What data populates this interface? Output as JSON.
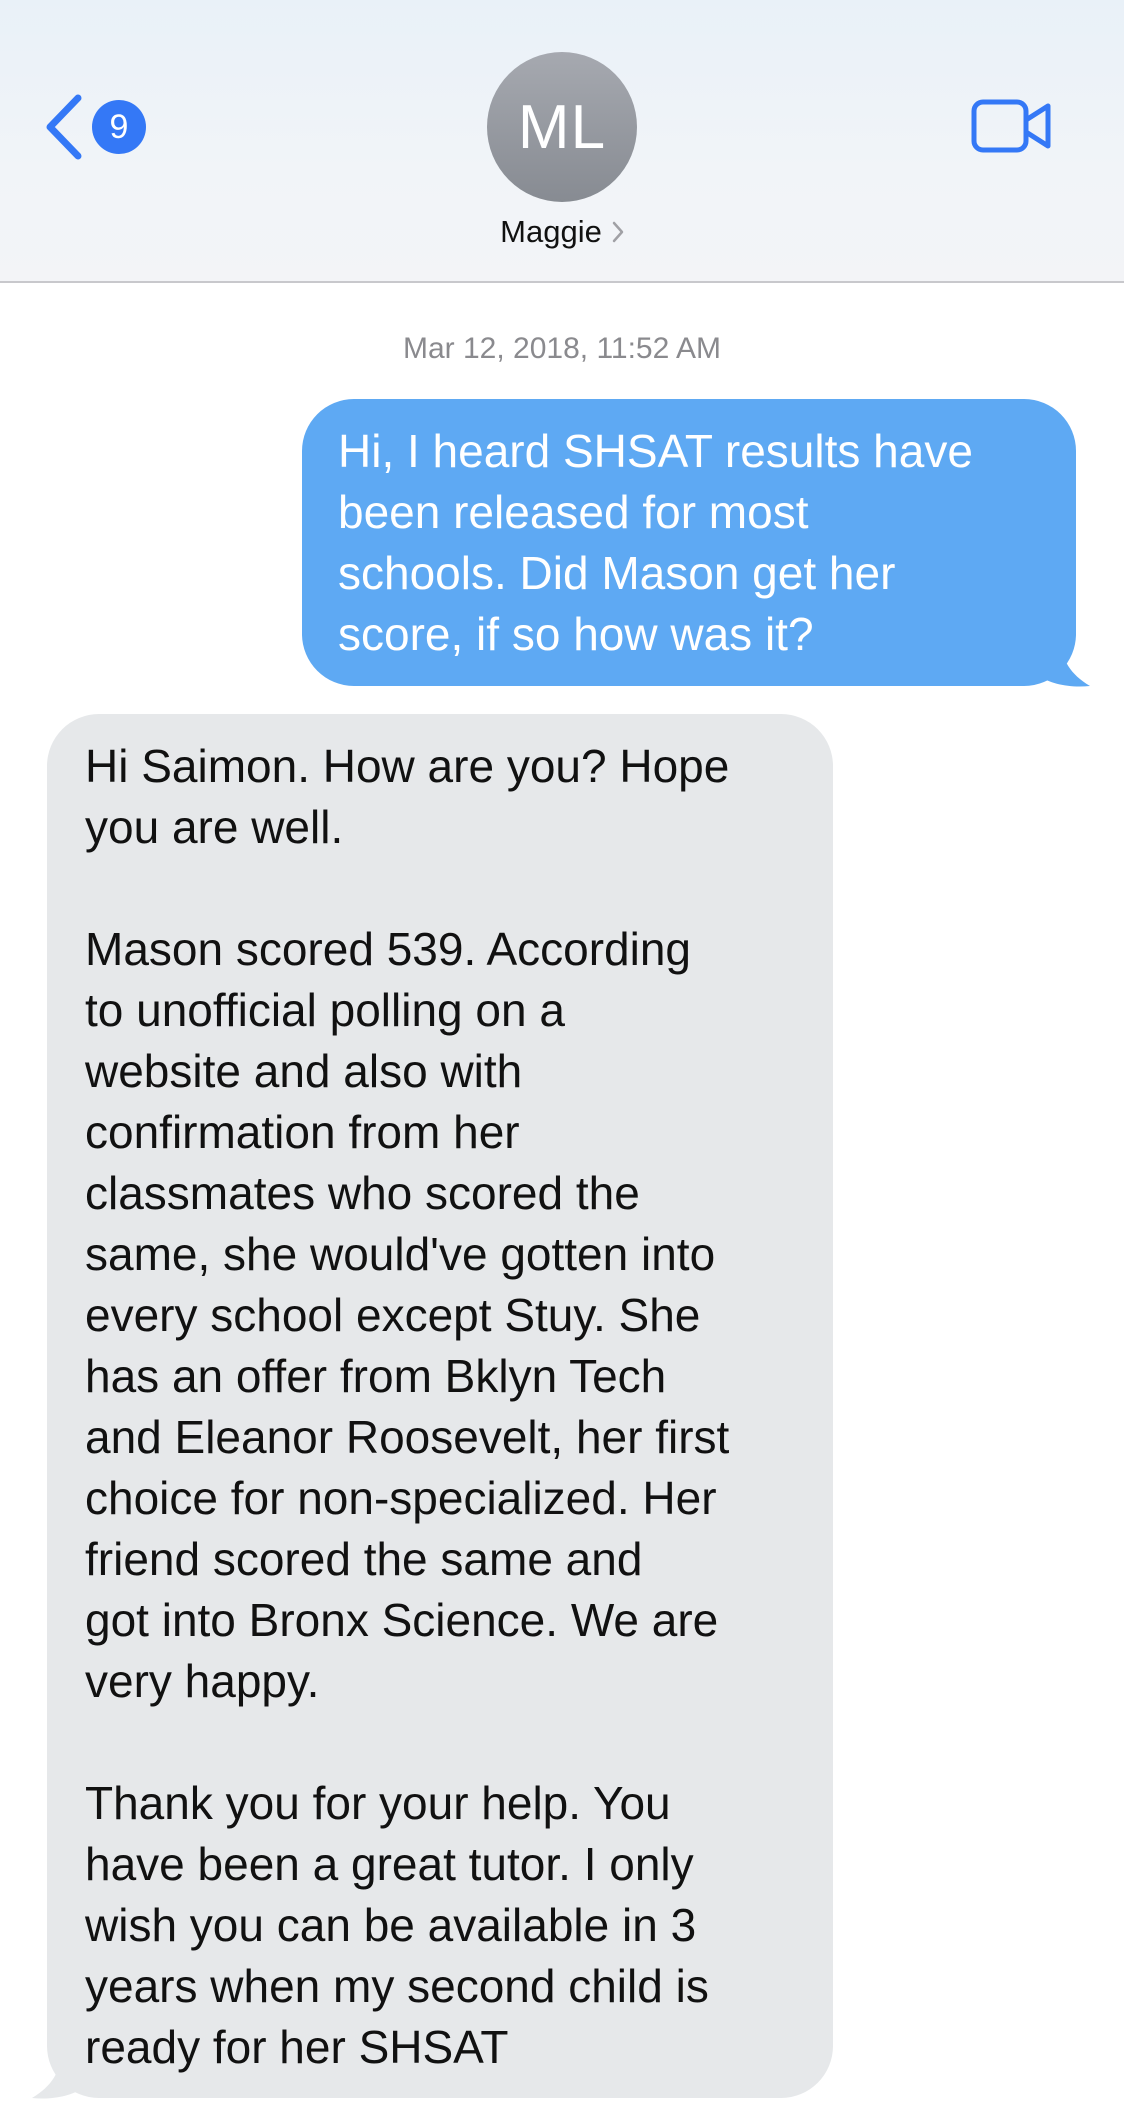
{
  "header": {
    "back_badge_count": "9",
    "avatar_initials": "ML",
    "contact_name": "Maggie"
  },
  "conversation": {
    "timestamp": "Mar 12, 2018, 11:52 AM",
    "messages": [
      {
        "direction": "sent",
        "text": "Hi, I heard SHSAT results have\nbeen released for most\nschools. Did Mason get her\nscore, if so how was it?"
      },
      {
        "direction": "received",
        "text": "Hi Saimon. How are you? Hope\nyou are well.\n\nMason scored 539. According\nto unofficial polling on a\nwebsite and also with\nconfirmation from her\nclassmates who scored the\nsame, she would've gotten into\nevery school except Stuy. She\nhas an offer from Bklyn Tech\nand Eleanor Roosevelt, her first\nchoice for non-specialized. Her\nfriend scored the same and\ngot into Bronx Science. We are\nvery happy.\n\nThank you for your help. You\nhave been a great tutor. I only\nwish you can be available in 3\nyears when my second child is\nready for her SHSAT"
      }
    ]
  },
  "colors": {
    "accent": "#3478f6",
    "sent_bubble": "#5ea9f3",
    "received_bubble": "#e6e8ea",
    "timestamp_text": "#8a8a8e"
  },
  "icons": {
    "back": "chevron-left-icon",
    "video": "video-camera-icon",
    "contact_chevron": "chevron-right-icon"
  }
}
